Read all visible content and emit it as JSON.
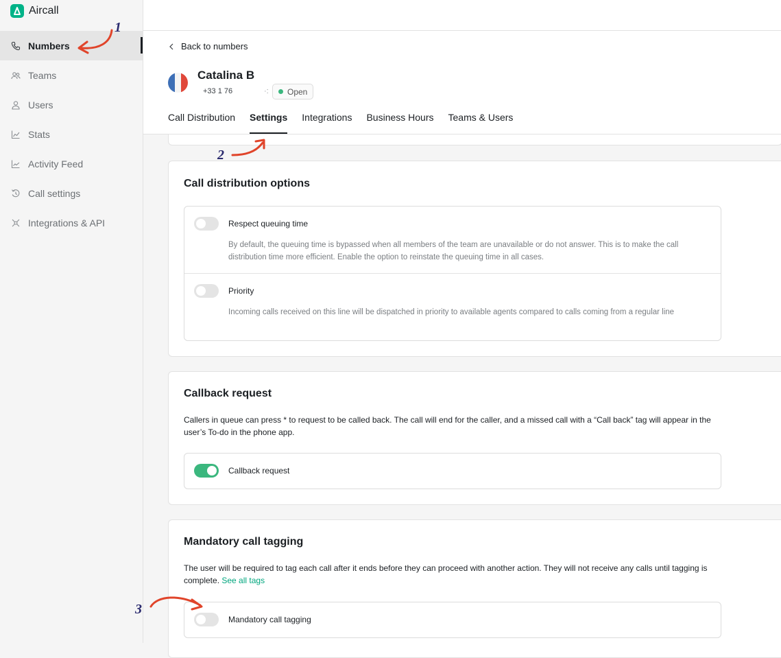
{
  "brand": {
    "name": "Aircall"
  },
  "sidebar": {
    "items": [
      {
        "label": "Numbers",
        "icon": "phone-icon",
        "active": true
      },
      {
        "label": "Teams",
        "icon": "teams-icon"
      },
      {
        "label": "Users",
        "icon": "user-icon"
      },
      {
        "label": "Stats",
        "icon": "stats-icon"
      },
      {
        "label": "Activity Feed",
        "icon": "activity-icon"
      },
      {
        "label": "Call settings",
        "icon": "call-settings-icon"
      },
      {
        "label": "Integrations & API",
        "icon": "integrations-icon"
      }
    ]
  },
  "header": {
    "back_label": "Back to numbers",
    "number_name": "Catalina B",
    "phone": "+33 1 76",
    "phone_redacted": "·:",
    "status": "Open",
    "tabs": [
      "Call Distribution",
      "Settings",
      "Integrations",
      "Business Hours",
      "Teams & Users"
    ],
    "active_tab": "Settings"
  },
  "cards": {
    "distribution": {
      "title": "Call distribution options",
      "options": [
        {
          "label": "Respect queuing time",
          "description": "By default, the queuing time is bypassed when all members of the team are unavailable or do not answer. This is to make the call distribution time more efficient. Enable the option to reinstate the queuing time in all cases.",
          "enabled": false
        },
        {
          "label": "Priority",
          "description": "Incoming calls received on this line will be dispatched in priority to available agents compared to calls coming from a regular line",
          "enabled": false
        }
      ]
    },
    "callback": {
      "title": "Callback request",
      "description": "Callers in queue can press * to request to be called back. The call will end for the caller, and a missed call with a “Call back” tag will appear in the user’s To-do in the phone app.",
      "option_label": "Callback request",
      "enabled": true
    },
    "tagging": {
      "title": "Mandatory call tagging",
      "description": "The user will be required to tag each call after it ends before they can proceed with another action. They will not receive any calls until tagging is complete.",
      "link": "See all tags",
      "option_label": "Mandatory call tagging",
      "enabled": false
    }
  },
  "annotations": {
    "step1": "1",
    "step2": "2",
    "step3": "3"
  },
  "colors": {
    "accent": "#00b388",
    "toggle_on": "#3bb77e",
    "annotation_arrow": "#e0442a",
    "annotation_number": "#2a2a6e"
  }
}
